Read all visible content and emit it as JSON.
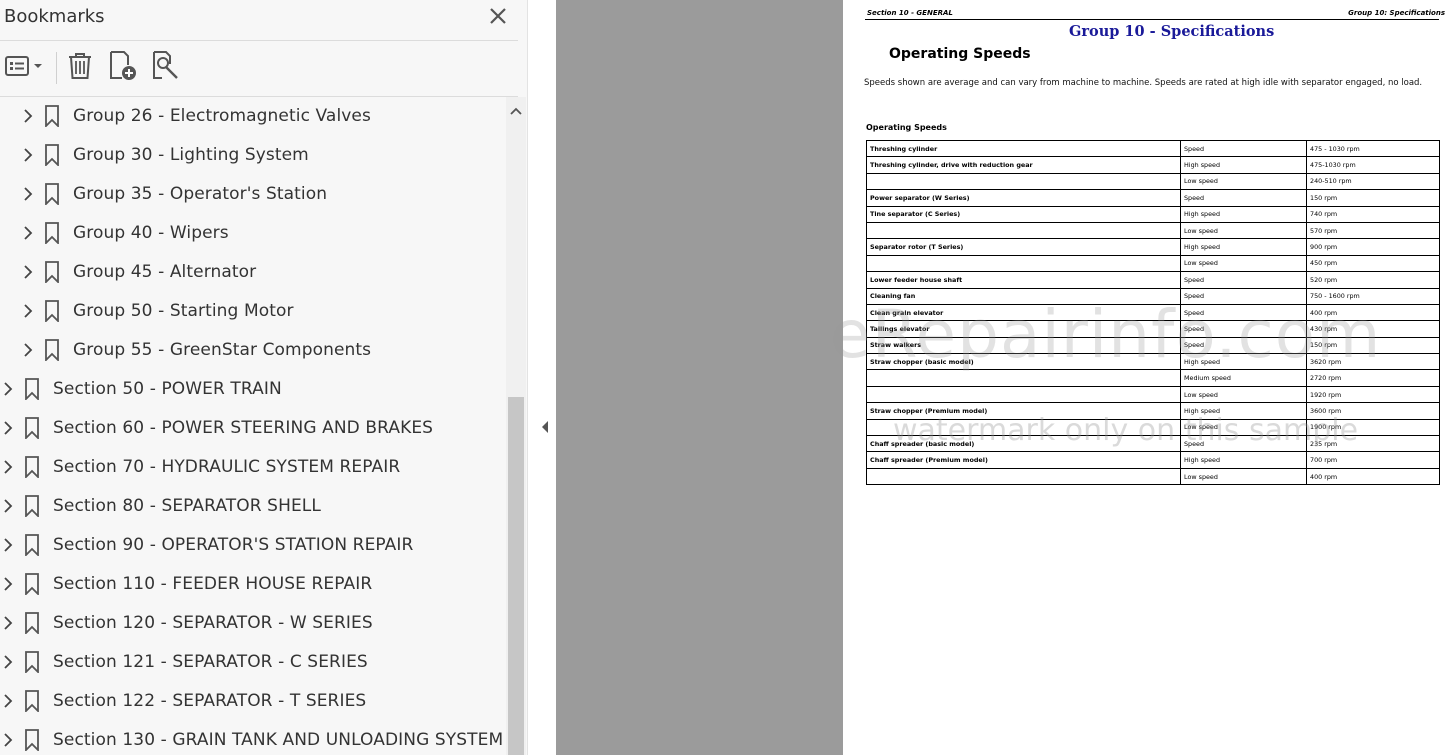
{
  "bookmarks_panel": {
    "title": "Bookmarks",
    "icons": {
      "close": "close-icon",
      "options": "bookmark-options-icon",
      "delete": "trash-icon",
      "add": "add-bookmark-icon",
      "search": "bookmark-search-icon"
    },
    "items": [
      {
        "label": "Group 26 - Electromagnetic Valves",
        "level": 2
      },
      {
        "label": "Group 30 - Lighting System",
        "level": 2
      },
      {
        "label": "Group 35 - Operator's Station",
        "level": 2
      },
      {
        "label": "Group 40 - Wipers",
        "level": 2
      },
      {
        "label": "Group 45 - Alternator",
        "level": 2
      },
      {
        "label": "Group 50 - Starting Motor",
        "level": 2
      },
      {
        "label": "Group 55 - GreenStar Components",
        "level": 2
      },
      {
        "label": "Section 50 - POWER TRAIN",
        "level": 1
      },
      {
        "label": "Section 60 - POWER STEERING AND BRAKES",
        "level": 1
      },
      {
        "label": "Section 70 - HYDRAULIC SYSTEM REPAIR",
        "level": 1
      },
      {
        "label": "Section 80 - SEPARATOR SHELL",
        "level": 1
      },
      {
        "label": "Section 90 - OPERATOR'S STATION REPAIR",
        "level": 1
      },
      {
        "label": "Section 110 - FEEDER HOUSE REPAIR",
        "level": 1
      },
      {
        "label": "Section 120 - SEPARATOR - W SERIES",
        "level": 1
      },
      {
        "label": "Section 121 - SEPARATOR - C SERIES",
        "level": 1
      },
      {
        "label": "Section 122 - SEPARATOR - T SERIES",
        "level": 1
      },
      {
        "label": "Section 130 - GRAIN TANK AND UNLOADING SYSTEM",
        "level": 1
      }
    ]
  },
  "document": {
    "header_left": "Section 10 - GENERAL",
    "header_right": "Group 10: Specifications",
    "group_title": "Group 10 - Specifications",
    "heading": "Operating Speeds",
    "paragraph": "Speeds shown are average and can vary from machine to machine. Speeds are rated at high idle with separator engaged, no load.",
    "table_title": "Operating Speeds",
    "table_rows": [
      [
        "Threshing cylinder",
        "Speed",
        "475 - 1030 rpm"
      ],
      [
        "Threshing cylinder, drive with reduction gear",
        "High speed",
        "475-1030 rpm"
      ],
      [
        "",
        "Low speed",
        "240-510 rpm"
      ],
      [
        "Power separator (W Series)",
        "Speed",
        "150 rpm"
      ],
      [
        "Tine separator (C Series)",
        "High speed",
        "740 rpm"
      ],
      [
        "",
        "Low speed",
        "570 rpm"
      ],
      [
        "Separator rotor (T Series)",
        "High speed",
        "900 rpm"
      ],
      [
        "",
        "Low speed",
        "450 rpm"
      ],
      [
        "Lower feeder house shaft",
        "Speed",
        "520 rpm"
      ],
      [
        "Cleaning fan",
        "Speed",
        "750 - 1600 rpm"
      ],
      [
        "Clean grain elevator",
        "Speed",
        "400 rpm"
      ],
      [
        "Tailings elevator",
        "Speed",
        "430 rpm"
      ],
      [
        "Straw walkers",
        "Speed",
        "150 rpm"
      ],
      [
        "Straw chopper (basic model)",
        "High speed",
        "3620 rpm"
      ],
      [
        "",
        "Medium speed",
        "2720 rpm"
      ],
      [
        "",
        "Low speed",
        "1920 rpm"
      ],
      [
        "Straw chopper (Premium model)",
        "High speed",
        "3600 rpm"
      ],
      [
        "",
        "Low speed",
        "1900 rpm"
      ],
      [
        "Chaff spreader (basic model)",
        "Speed",
        "235 rpm"
      ],
      [
        "Chaff spreader (Premium model)",
        "High speed",
        "700 rpm"
      ],
      [
        "",
        "Low speed",
        "400 rpm"
      ]
    ],
    "watermark_main": "eRepairinfo.com",
    "watermark_sub": "watermark only on this sample"
  },
  "colors": {
    "group_title": "#1a1a99",
    "panel_bg": "#f7f7f7",
    "viewer_gray": "#9b9b9b"
  }
}
